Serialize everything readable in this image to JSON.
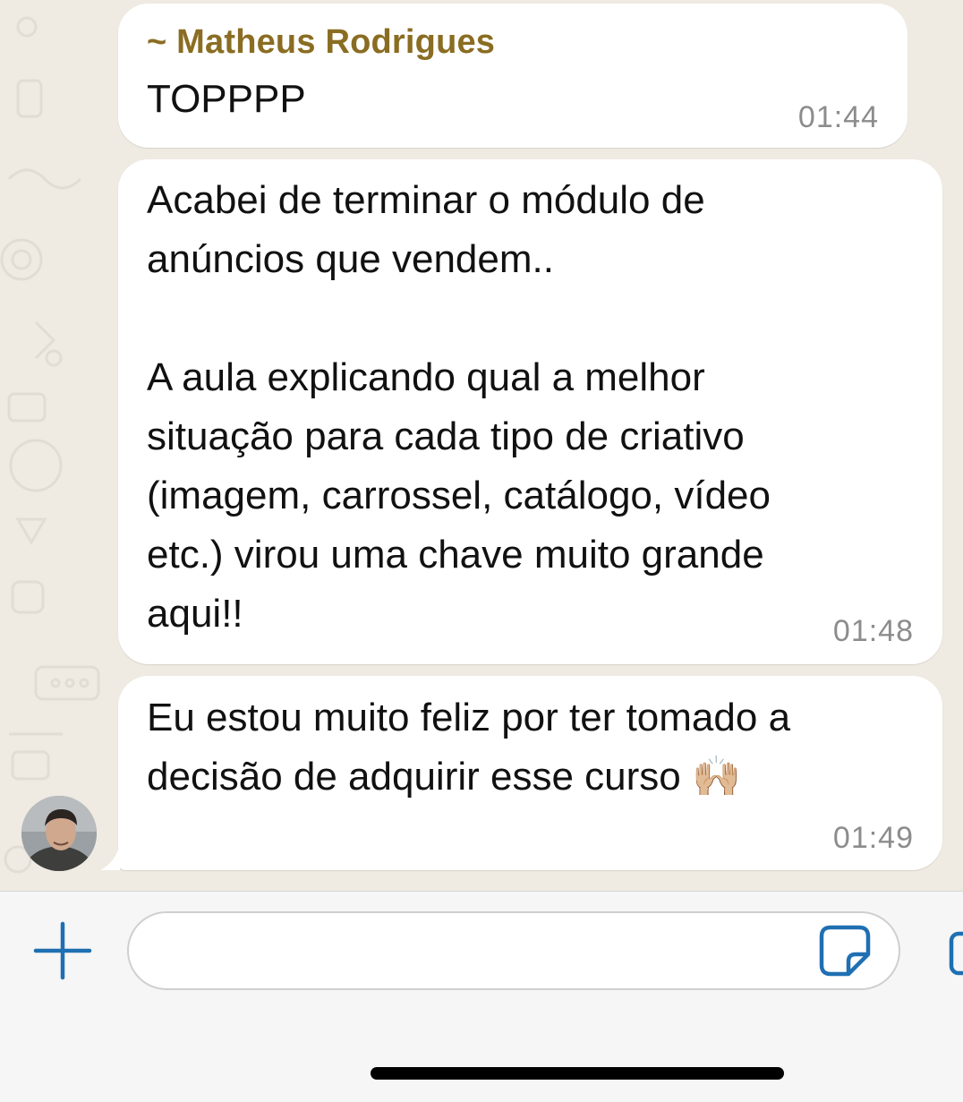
{
  "messages": [
    {
      "sender": "~ Matheus Rodrigues",
      "text": "TOPPPP",
      "time": "01:44"
    },
    {
      "text": "Acabei de terminar o módulo de\nanúncios que vendem..\n\nA aula explicando qual a melhor\nsituação para cada tipo de criativo\n(imagem, carrossel, catálogo, vídeo\netc.) virou uma chave muito grande\naqui!!",
      "time": "01:48"
    },
    {
      "text": "Eu estou muito feliz por ter tomado a\ndecisão de adquirir esse curso 🙌🏼",
      "time": "01:49"
    }
  ],
  "composer": {
    "value": "",
    "placeholder": "",
    "icons": [
      "plus-icon",
      "sticker-icon",
      "camera-icon"
    ]
  },
  "colors": {
    "sender_name": "#8a6d22",
    "accent": "#1f6fb2",
    "chat_background": "#efeae2",
    "bubble": "#ffffff",
    "timestamp": "#8c8c8c"
  }
}
